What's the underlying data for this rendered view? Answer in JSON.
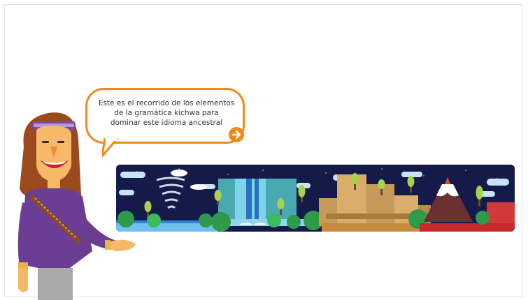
{
  "speech_bubble": {
    "line1": "Este es el recorrido de los elementos",
    "line2": "de la gramática kichwa para",
    "line3": "dominar este idioma ancestral"
  },
  "next_button": {
    "icon": "arrow-right-icon"
  },
  "colors": {
    "accent": "#f08a1c",
    "banner_sky": "#141a4a",
    "shirt": "#6b3d93"
  }
}
